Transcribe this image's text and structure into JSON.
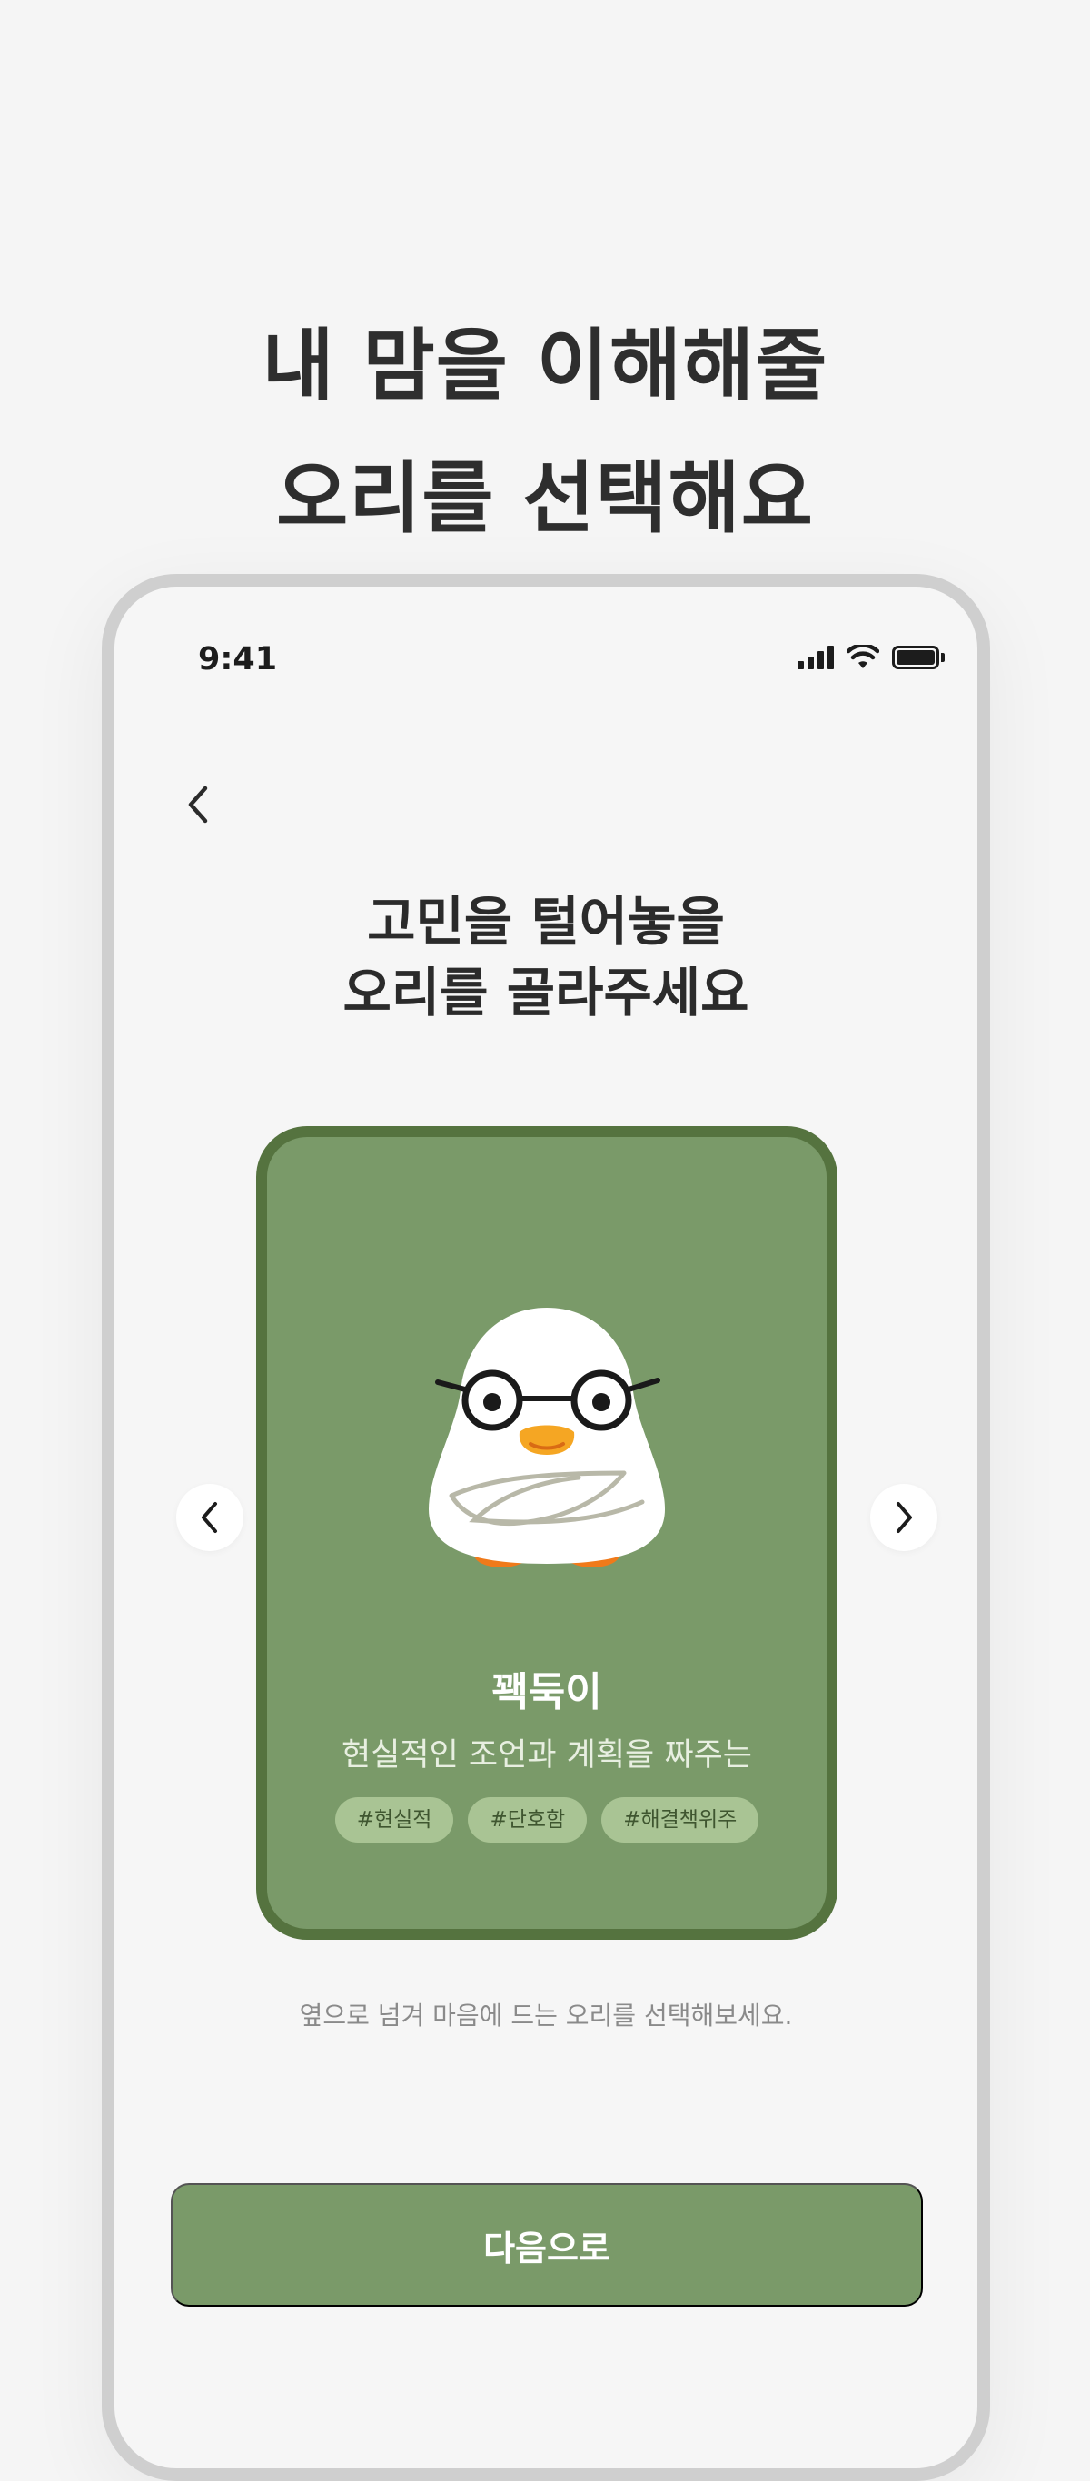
{
  "promo": {
    "title_line1": "내 맘을 이해해줄",
    "title_line2": "오리를 선택해요"
  },
  "status_bar": {
    "time": "9:41",
    "icons": [
      "signal-icon",
      "wifi-icon",
      "battery-icon"
    ]
  },
  "header": {
    "back_icon": "chevron-left-icon"
  },
  "screen": {
    "title_line1": "고민을 털어놓을",
    "title_line2": "오리를 골라주세요"
  },
  "duck_card": {
    "name": "꽥둑이",
    "description": "현실적인 조언과 계획을 짜주는",
    "tags": [
      "#현실적",
      "#단호함",
      "#해결책위주"
    ],
    "colors": {
      "card_bg": "#7a9a69",
      "card_border": "#55733f",
      "tag_bg": "#a9c494"
    }
  },
  "carousel": {
    "prev_icon": "chevron-left-icon",
    "next_icon": "chevron-right-icon"
  },
  "hint": "옆으로 넘겨 마음에 드는 오리를 선택해보세요.",
  "next_button_label": "다음으로",
  "colors": {
    "accent": "#7a9a69",
    "background": "#f5f5f5"
  }
}
